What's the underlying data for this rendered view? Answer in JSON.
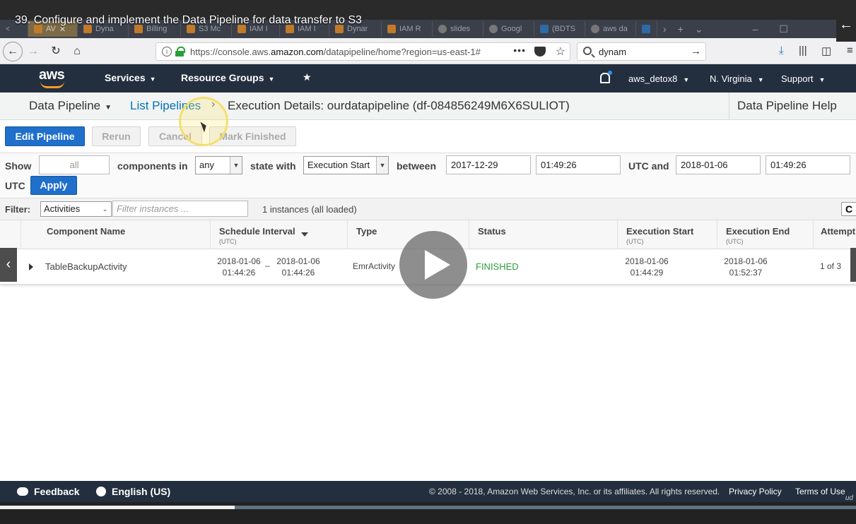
{
  "video": {
    "title": "39. Configure and implement the Data Pipeline for data transfer to S3",
    "progress": 0.274,
    "back_glyph": "←"
  },
  "browser": {
    "tabs": [
      "AV",
      "Dyna",
      "Billing",
      "S3 Mc",
      "IAM I",
      "IAM I",
      "Dynar",
      "IAM R",
      "slides",
      "Googl",
      "(BDTS",
      "aws da",
      ""
    ],
    "url_prefix": "https://console.aws.",
    "url_domain": "amazon.com",
    "url_rest": "/datapipeline/home?region=us-east-1#",
    "search_value": "dynam"
  },
  "aws": {
    "services": "Services",
    "resource_groups": "Resource Groups",
    "account": "aws_detox8",
    "region": "N. Virginia",
    "support": "Support",
    "logo_text": "aws"
  },
  "breadcrumb": {
    "service": "Data Pipeline",
    "list": "List Pipelines",
    "current": "Execution Details: ourdatapipeline (df-084856249M6X6SULIOT)",
    "help": "Data Pipeline Help"
  },
  "toolbar": {
    "edit": "Edit Pipeline",
    "rerun": "Rerun",
    "cancel": "Cancel",
    "mark": "Mark Finished"
  },
  "filters": {
    "show_label": "Show",
    "show_value": "all",
    "components_label": "components in",
    "components_value": "any",
    "state_label": "state with",
    "state_value": "Execution Start",
    "between_label": "between",
    "start_date": "2017-12-29",
    "start_time": "01:49:26",
    "utc_and": "UTC and",
    "end_date": "2018-01-06",
    "end_time": "01:49:26",
    "utc": "UTC",
    "apply": "Apply",
    "filter_label": "Filter:",
    "filter_type": "Activities",
    "filter_placeholder": "Filter instances ...",
    "instances": "1 instances (all loaded)"
  },
  "table": {
    "headers": {
      "component": "Component Name",
      "schedule": "Schedule Interval",
      "schedule_unit": "(UTC)",
      "type": "Type",
      "status": "Status",
      "exec_start": "Execution Start",
      "exec_start_unit": "(UTC)",
      "exec_end": "Execution End",
      "exec_end_unit": "(UTC)",
      "attempts": "Attempt"
    },
    "rows": [
      {
        "component": "TableBackupActivity",
        "sched_start_date": "2018-01-06",
        "sched_start_time": "01:44:26",
        "sched_sep": "–",
        "sched_end_date": "2018-01-06",
        "sched_end_time": "01:44:26",
        "type": "EmrActivity",
        "status": "FINISHED",
        "start_date": "2018-01-06",
        "start_time": "01:44:29",
        "end_date": "2018-01-06",
        "end_time": "01:52:37",
        "attempts": "1 of 3"
      }
    ]
  },
  "footer": {
    "feedback": "Feedback",
    "language": "English (US)",
    "copyright": "© 2008 - 2018, Amazon Web Services, Inc. or its affiliates. All rights reserved.",
    "privacy": "Privacy Policy",
    "terms": "Terms of Use"
  },
  "colors": {
    "aws_dark": "#232f3e",
    "link": "#0073bb",
    "primary": "#1f6fcb",
    "finished": "#2a9d3a",
    "aws_orange": "#f79c2b"
  }
}
